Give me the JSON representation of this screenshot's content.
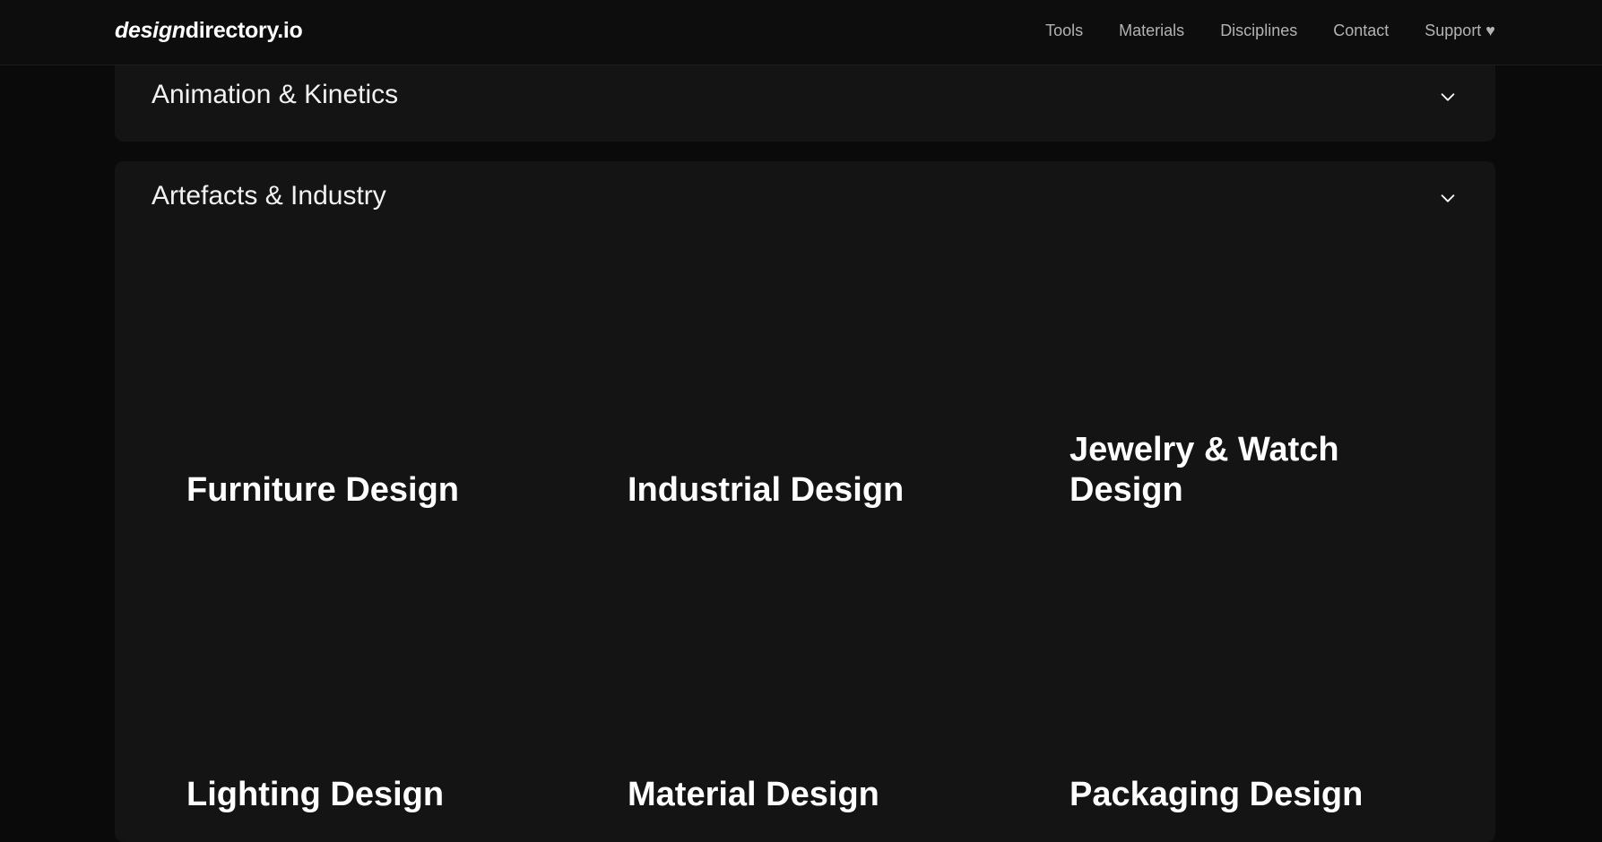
{
  "header": {
    "logo_italic": "design",
    "logo_rest": "directory.io",
    "nav": [
      "Tools",
      "Materials",
      "Disciplines",
      "Contact",
      "Support ♥"
    ]
  },
  "sections": [
    {
      "title": "Animation & Kinetics",
      "expanded": false,
      "icon": "chevron-down-icon"
    },
    {
      "title": "Artefacts & Industry",
      "expanded": true,
      "icon": "chevron-down-icon",
      "cards": [
        "Furniture Design",
        "Industrial Design",
        "Jewelry & Watch Design",
        "Lighting Design",
        "Material Design",
        "Packaging Design"
      ]
    }
  ],
  "colors": {
    "background": "#0a0a0a",
    "panel": "#141414",
    "text": "#ffffff",
    "nav_text": "#b3b3b3"
  }
}
